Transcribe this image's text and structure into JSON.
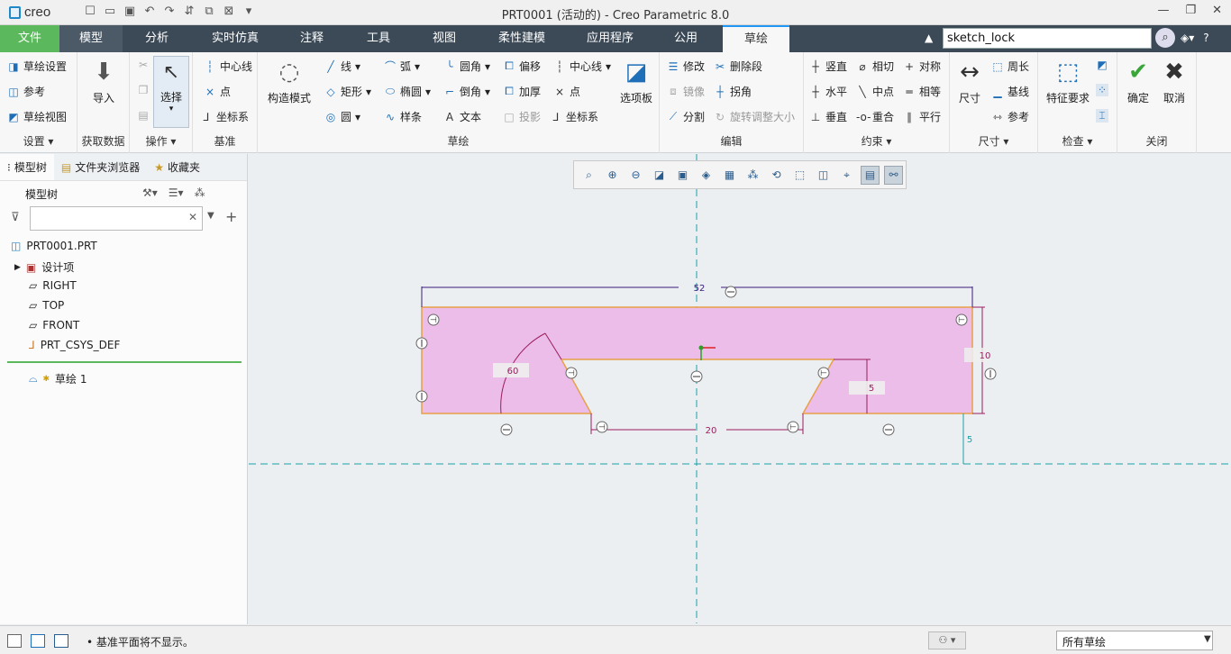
{
  "app": {
    "logo_text": "creo",
    "window_title": "PRT0001 (活动的) - Creo Parametric 8.0",
    "brand_color": "#1e88c8"
  },
  "quick_access": {
    "icons": [
      "new-icon",
      "open-icon",
      "save-icon",
      "undo-icon",
      "redo-icon",
      "regenerate-icon",
      "windows-icon",
      "close-window-icon",
      "customize-icon"
    ]
  },
  "window_controls": [
    "minimize-icon",
    "restore-icon",
    "close-icon"
  ],
  "tabs": [
    {
      "label": "文件"
    },
    {
      "label": "模型"
    },
    {
      "label": "分析"
    },
    {
      "label": "实时仿真"
    },
    {
      "label": "注释"
    },
    {
      "label": "工具"
    },
    {
      "label": "视图"
    },
    {
      "label": "柔性建模"
    },
    {
      "label": "应用程序"
    },
    {
      "label": "公用"
    },
    {
      "label": "草绘"
    }
  ],
  "command_search": {
    "value": "sketch_lock"
  },
  "ribbon": {
    "setup": {
      "label": "设置",
      "items": [
        "草绘设置",
        "参考",
        "草绘视图"
      ]
    },
    "get_data": {
      "label": "获取数据",
      "import": "导入"
    },
    "operations": {
      "label": "操作",
      "select": "选择"
    },
    "datum": {
      "label": "基准",
      "items": [
        "中心线",
        "点",
        "坐标系"
      ]
    },
    "construction_mode": "构造模式",
    "sketching": {
      "label": "草绘",
      "col1": [
        "线",
        "矩形",
        "圆"
      ],
      "col2": [
        "弧",
        "椭圆",
        "样条"
      ],
      "col3": [
        "圆角",
        "倒角",
        "文本"
      ],
      "col4": [
        "偏移",
        "加厚",
        "投影"
      ],
      "col5": [
        "中心线",
        "点",
        "坐标系"
      ],
      "palette": "选项板"
    },
    "editing": {
      "label": "编辑",
      "items": [
        "修改",
        "删除段",
        "镜像",
        "拐角",
        "分割",
        "旋转调整大小"
      ]
    },
    "constrain": {
      "label": "约束",
      "items": [
        "竖直",
        "相切",
        "对称",
        "水平",
        "中点",
        "相等",
        "垂直",
        "重合",
        "平行"
      ]
    },
    "dimension": {
      "label": "尺寸",
      "big": "尺寸",
      "items": [
        "周长",
        "基线",
        "参考"
      ]
    },
    "inspect": {
      "label": "检查",
      "big": "特征要求"
    },
    "close": {
      "label": "关闭",
      "ok": "确定",
      "cancel": "取消"
    }
  },
  "left_panel": {
    "tabs": [
      "模型树",
      "文件夹浏览器",
      "收藏夹"
    ],
    "tree_header": "模型树",
    "filter_placeholder": "",
    "items": [
      "PRT0001.PRT",
      "设计项",
      "RIGHT",
      "TOP",
      "FRONT",
      "PRT_CSYS_DEF"
    ],
    "sketch_item": "草绘 1"
  },
  "view_toolbar": {
    "icons": [
      "refit-icon",
      "zoom-in-icon",
      "zoom-out-icon",
      "repaint-icon",
      "display-style-icon",
      "saved-views-icon",
      "view-manager-icon",
      "datum-display-icon",
      "annotation-display-icon",
      "spin-center-icon",
      "perspective-icon",
      "sketch-view-icon",
      "sketch-display-filter-icon",
      "constraint-display-icon"
    ]
  },
  "sketch": {
    "dimensions": {
      "overall_width": "52",
      "height": "10",
      "angle": "60",
      "slot_width": "20",
      "right_step": "5",
      "offset": "5"
    },
    "colors": {
      "fill": "#ecbde8",
      "edge": "#e8a048",
      "dimension": "#9b1d5e",
      "axis": "#1aa0a8",
      "top_dim": "#3a1b7a"
    }
  },
  "status": {
    "message": "基准平面将不显示。",
    "filter": "所有草绘"
  }
}
